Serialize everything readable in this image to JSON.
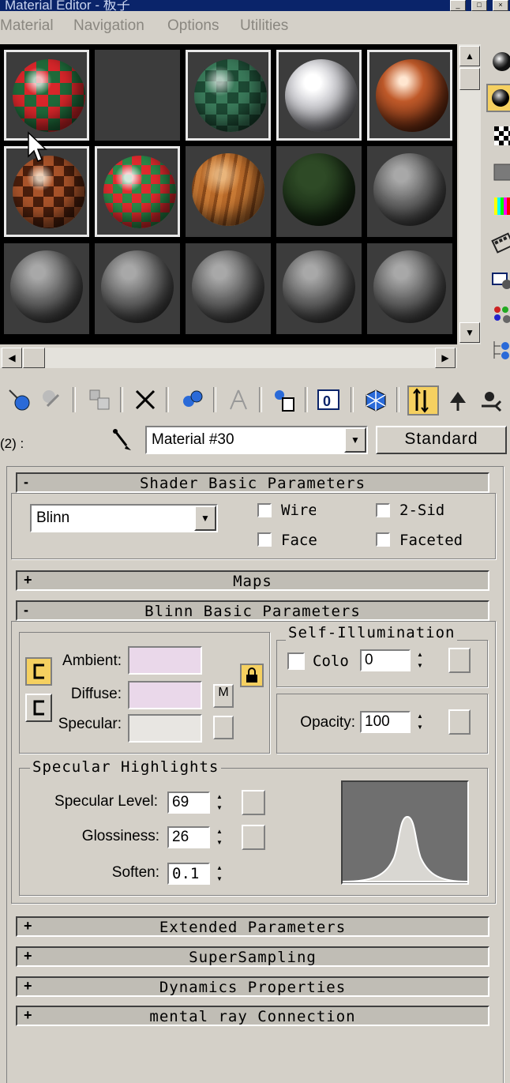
{
  "window": {
    "title": "Material Editor - 板子"
  },
  "menu": {
    "items": [
      "Material",
      "Navigation",
      "Options",
      "Utilities"
    ]
  },
  "slots": [
    {
      "kind": "checker-red-green",
      "selected": true
    },
    {
      "kind": "empty",
      "selected": false
    },
    {
      "kind": "checker-green",
      "selected": true
    },
    {
      "kind": "white-glossy",
      "selected": true
    },
    {
      "kind": "copper",
      "selected": true
    },
    {
      "kind": "copper-checker",
      "selected": true
    },
    {
      "kind": "checker-red-green-bright",
      "selected": true
    },
    {
      "kind": "wood",
      "selected": false
    },
    {
      "kind": "dark-green",
      "selected": false
    },
    {
      "kind": "gray",
      "selected": false
    },
    {
      "kind": "gray",
      "selected": false
    },
    {
      "kind": "gray",
      "selected": false
    },
    {
      "kind": "gray",
      "selected": false
    },
    {
      "kind": "gray",
      "selected": false
    },
    {
      "kind": "gray",
      "selected": false
    }
  ],
  "side_tools": [
    "sample-type-icon",
    "backlight-icon",
    "background-checker-icon",
    "uv-tiling-icon",
    "video-color-check-icon",
    "make-preview-icon",
    "options-icon",
    "select-by-material-icon",
    "material-navigator-icon"
  ],
  "toolbar": {
    "tools": [
      "get-material-icon",
      "put-to-scene-icon",
      "assign-to-selection-icon",
      "reset-map-icon",
      "make-unique-icon",
      "put-to-library-icon",
      "material-effects-channel-icon",
      "show-map-in-viewport-icon",
      "show-end-result-icon",
      "go-to-parent-icon",
      "go-forward-icon"
    ]
  },
  "material": {
    "prefix": "(2) :",
    "name": "Material #30",
    "type_button": "Standard"
  },
  "shader_rollout": {
    "title": "Shader Basic Parameters",
    "sign": "-",
    "shader": "Blinn",
    "checkboxes": [
      "Wire",
      "2-Sid",
      "Face",
      "Faceted"
    ]
  },
  "maps_rollout": {
    "title": "Maps",
    "sign": "+"
  },
  "blinn_rollout": {
    "title": "Blinn Basic Parameters",
    "sign": "-",
    "ambient_label": "Ambient:",
    "diffuse_label": "Diffuse:",
    "specular_label": "Specular:",
    "ambient_color": "#ead8ea",
    "diffuse_color": "#ead8ea",
    "specular_color": "#e8e6e2",
    "map_button": "M",
    "self_illum_title": "Self-Illumination",
    "color_label": "Colo",
    "self_illum_value": "0",
    "opacity_label": "Opacity:",
    "opacity_value": "100",
    "spec_title": "Specular Highlights",
    "spec_level_label": "Specular Level:",
    "spec_level_value": "69",
    "glossiness_label": "Glossiness:",
    "glossiness_value": "26",
    "soften_label": "Soften:",
    "soften_value": "0.1"
  },
  "collapsed_rollouts": [
    {
      "title": "Extended Parameters",
      "sign": "+"
    },
    {
      "title": "SuperSampling",
      "sign": "+"
    },
    {
      "title": "Dynamics Properties",
      "sign": "+"
    },
    {
      "title": "mental ray Connection",
      "sign": "+"
    }
  ],
  "colors": {
    "accent_yellow": "#f5d060",
    "panel": "#d4d0c8",
    "rollout_header": "#c0bdb5"
  }
}
